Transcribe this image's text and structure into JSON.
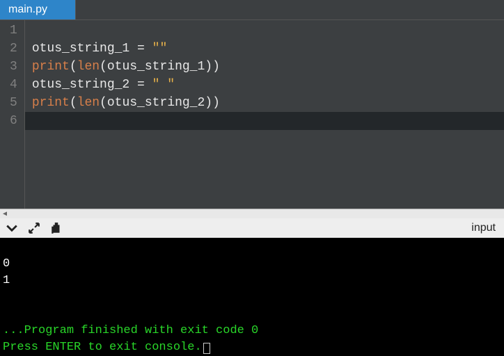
{
  "tab": {
    "filename": "main.py"
  },
  "editor": {
    "line_numbers": [
      "1",
      "2",
      "3",
      "4",
      "5",
      "6"
    ],
    "lines": [
      {
        "tokens": []
      },
      {
        "tokens": [
          {
            "t": "otus_string_1 ",
            "c": "tk-id"
          },
          {
            "t": "=",
            "c": "tk-op"
          },
          {
            "t": " ",
            "c": "tk-id"
          },
          {
            "t": "\"\"",
            "c": "tk-str"
          }
        ]
      },
      {
        "tokens": [
          {
            "t": "print",
            "c": "tk-fn"
          },
          {
            "t": "(",
            "c": "tk-op"
          },
          {
            "t": "len",
            "c": "tk-builtin"
          },
          {
            "t": "(otus_string_1))",
            "c": "tk-op"
          }
        ]
      },
      {
        "tokens": [
          {
            "t": "otus_string_2 ",
            "c": "tk-id"
          },
          {
            "t": "=",
            "c": "tk-op"
          },
          {
            "t": " ",
            "c": "tk-id"
          },
          {
            "t": "\" \"",
            "c": "tk-str"
          }
        ]
      },
      {
        "tokens": [
          {
            "t": "print",
            "c": "tk-fn"
          },
          {
            "t": "(",
            "c": "tk-op"
          },
          {
            "t": "len",
            "c": "tk-builtin"
          },
          {
            "t": "(otus_string_2))",
            "c": "tk-op"
          }
        ]
      },
      {
        "tokens": [],
        "current": true
      }
    ]
  },
  "toolbar": {
    "input_label": "input"
  },
  "console": {
    "out1": "0",
    "out2": "1",
    "finished": "...Program finished with exit code 0",
    "prompt": "Press ENTER to exit console."
  }
}
